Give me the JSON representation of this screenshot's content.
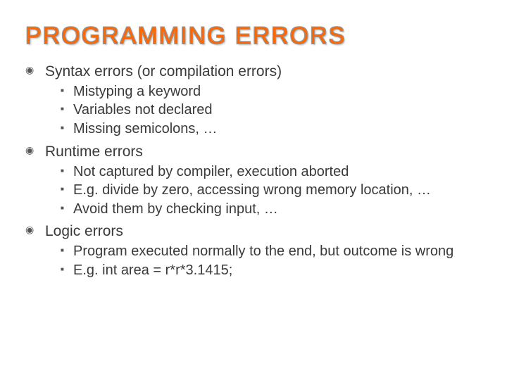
{
  "title": "PROGRAMMING ERRORS",
  "items": [
    {
      "label": "Syntax errors (or compilation errors)",
      "sub": [
        "Mistyping a keyword",
        "Variables not declared",
        "Missing semicolons, …"
      ]
    },
    {
      "label": "Runtime errors",
      "sub": [
        "Not captured by compiler, execution aborted",
        "E.g. divide by zero, accessing wrong memory location, …",
        "Avoid them by checking input, …"
      ]
    },
    {
      "label": "Logic errors",
      "sub": [
        "Program executed normally to the end, but outcome is wrong",
        "E.g.  int area = r*r*3.1415;"
      ]
    }
  ]
}
